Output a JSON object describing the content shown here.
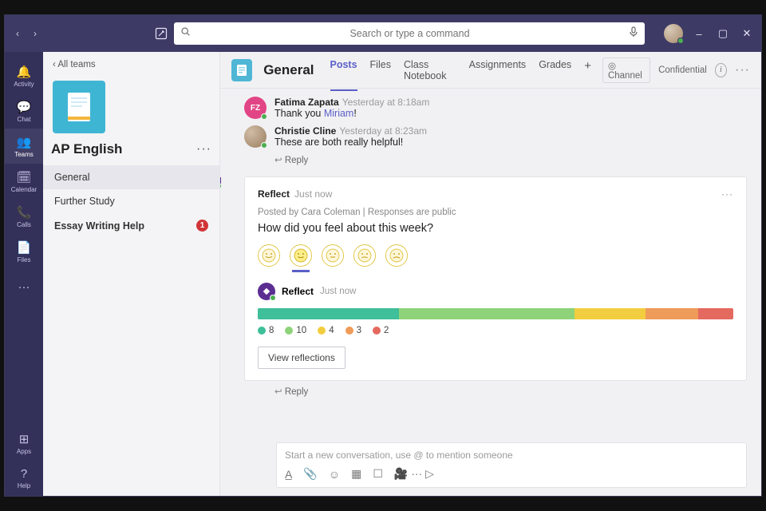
{
  "colors": {
    "titlebar": "#3d3a66",
    "rail": "#33305a",
    "accent": "#5b5fc7",
    "badge": "#d13438"
  },
  "titlebar": {
    "search_placeholder": "Search or type a command",
    "window": {
      "min": "–",
      "max": "▢",
      "close": "✕"
    }
  },
  "rail": {
    "items": [
      {
        "label": "Activity",
        "icon": "bell"
      },
      {
        "label": "Chat",
        "icon": "chat"
      },
      {
        "label": "Teams",
        "icon": "teams"
      },
      {
        "label": "Calendar",
        "icon": "calendar"
      },
      {
        "label": "Calls",
        "icon": "phone"
      },
      {
        "label": "Files",
        "icon": "file"
      }
    ],
    "more": "···",
    "bottom": [
      {
        "label": "Apps",
        "icon": "apps"
      },
      {
        "label": "Help",
        "icon": "help"
      }
    ]
  },
  "sidebar": {
    "back": "‹ All teams",
    "team_name": "AP English",
    "more": "···",
    "channels": [
      {
        "label": "General",
        "selected": true,
        "bold": false,
        "badge": null
      },
      {
        "label": "Further Study",
        "selected": false,
        "bold": false,
        "badge": null
      },
      {
        "label": "Essay Writing Help",
        "selected": false,
        "bold": true,
        "badge": "1"
      }
    ]
  },
  "header": {
    "channel": "General",
    "tabs": [
      {
        "label": "Posts",
        "active": true
      },
      {
        "label": "Files",
        "active": false
      },
      {
        "label": "Class Notebook",
        "active": false
      },
      {
        "label": "Assignments",
        "active": false
      },
      {
        "label": "Grades",
        "active": false
      }
    ],
    "add_tab": "+",
    "right": {
      "channel_pill": "◎ Channel",
      "confidential": "Confidential",
      "more": "···"
    }
  },
  "thread1": {
    "m1": {
      "initials": "FZ",
      "author": "Fatima Zapata",
      "ts": "Yesterday at 8:18am",
      "body_a": "Thank you ",
      "mention": "Miriam",
      "body_b": "!"
    },
    "m2": {
      "author": "Christie Cline",
      "ts": "Yesterday at 8:23am",
      "body": "These are both really helpful!"
    },
    "reply": "Reply"
  },
  "reflect": {
    "app": "Reflect",
    "ts": "Just now",
    "more": "···",
    "sub": "Posted by Cara Coleman  |  Responses are public",
    "question": "How did you feel about this week?",
    "emojis": [
      "very-happy",
      "happy",
      "neutral",
      "sad",
      "very-sad"
    ],
    "selected_index": 1,
    "inner": {
      "app": "Reflect",
      "ts": "Just now"
    },
    "view_btn": "View reflections",
    "reply": "Reply"
  },
  "chart_data": {
    "type": "bar",
    "title": "",
    "categories": [
      "very-happy",
      "happy",
      "neutral",
      "sad",
      "very-sad"
    ],
    "values": [
      8,
      10,
      4,
      3,
      2
    ],
    "colors": [
      "#3fbf9a",
      "#8ed37a",
      "#f2cd3f",
      "#ef9b59",
      "#e4695f"
    ],
    "xlabel": "",
    "ylabel": "",
    "ylim": [
      0,
      27
    ]
  },
  "composer": {
    "placeholder": "Start a new conversation, use @ to mention someone",
    "tools": [
      "format",
      "attach",
      "emoji",
      "gif",
      "sticker",
      "meet",
      "more"
    ],
    "send": "▷"
  }
}
